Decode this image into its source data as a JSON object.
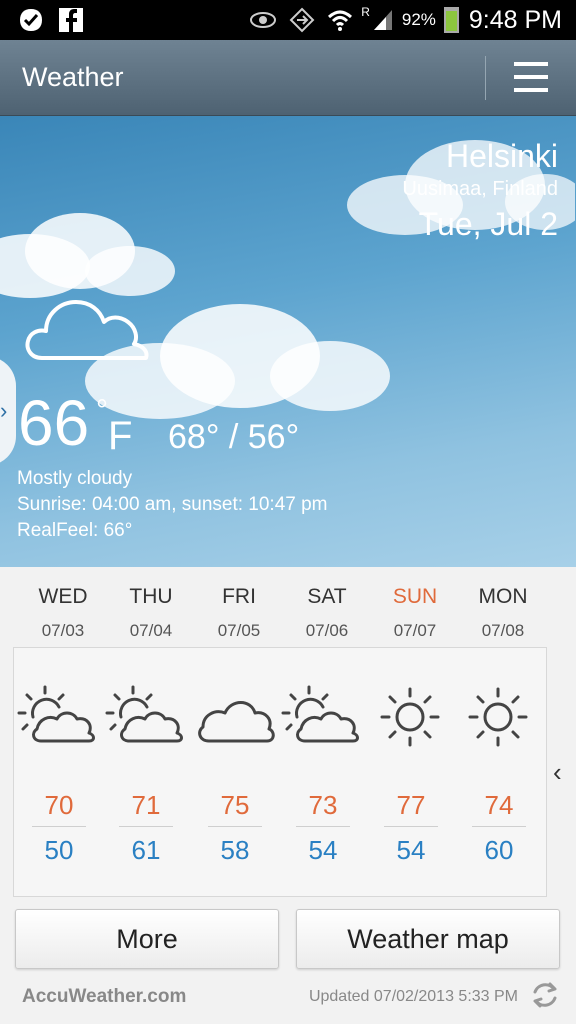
{
  "status_bar": {
    "battery": "92%",
    "time": "9:48 PM",
    "signal_label": "R",
    "icons": [
      "checkmark-icon",
      "facebook-icon",
      "eye-icon",
      "location-icon",
      "wifi-icon",
      "signal-icon",
      "battery-icon"
    ]
  },
  "action_bar": {
    "title": "Weather",
    "menu_icon": "menu-icon"
  },
  "current": {
    "city": "Helsinki",
    "region": "Uusimaa, Finland",
    "date": "Tue, Jul 2",
    "temp": "66",
    "unit": "F",
    "hi_lo": "68° / 56°",
    "condition": "Mostly cloudy",
    "sunrise_sunset": "Sunrise: 04:00 am, sunset: 10:47 pm",
    "realfeel": "RealFeel: 66°",
    "icon": "cloud-icon"
  },
  "forecast": [
    {
      "day": "WED",
      "date": "07/03",
      "icon": "partly-cloudy-icon",
      "high": "70",
      "low": "50",
      "day_color": "#333333"
    },
    {
      "day": "THU",
      "date": "07/04",
      "icon": "partly-cloudy-icon",
      "high": "71",
      "low": "61",
      "day_color": "#333333"
    },
    {
      "day": "FRI",
      "date": "07/05",
      "icon": "cloud-icon",
      "high": "75",
      "low": "58",
      "day_color": "#333333"
    },
    {
      "day": "SAT",
      "date": "07/06",
      "icon": "partly-cloudy-icon",
      "high": "73",
      "low": "54",
      "day_color": "#333333"
    },
    {
      "day": "SUN",
      "date": "07/07",
      "icon": "sun-icon",
      "high": "77",
      "low": "54",
      "day_color": "#e06a3b"
    },
    {
      "day": "MON",
      "date": "07/08",
      "icon": "sun-icon",
      "high": "74",
      "low": "60",
      "day_color": "#333333"
    }
  ],
  "buttons": {
    "more": "More",
    "weather_map": "Weather map"
  },
  "footer": {
    "brand": "AccuWeather.com",
    "updated": "Updated 07/02/2013 5:33 PM"
  },
  "colors": {
    "high_temp": "#e06a3b",
    "low_temp": "#2a80c3"
  }
}
